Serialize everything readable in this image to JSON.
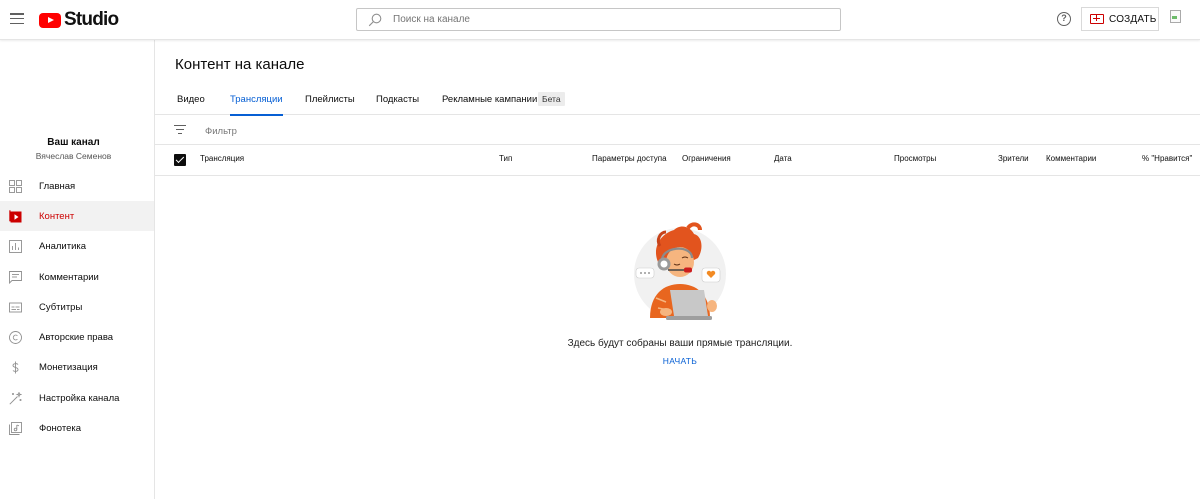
{
  "header": {
    "logo_text": "Studio",
    "search_placeholder": "Поиск на канале",
    "help_symbol": "?",
    "create_label": "СОЗДАТЬ"
  },
  "sidebar": {
    "channel_title": "Ваш канал",
    "channel_name": "Вячеслав Семенов",
    "items": [
      {
        "label": "Главная",
        "icon": "dashboard-icon"
      },
      {
        "label": "Контент",
        "icon": "content-icon",
        "active": true
      },
      {
        "label": "Аналитика",
        "icon": "analytics-icon"
      },
      {
        "label": "Комментарии",
        "icon": "comments-icon"
      },
      {
        "label": "Субтитры",
        "icon": "subtitles-icon"
      },
      {
        "label": "Авторские права",
        "icon": "copyright-icon"
      },
      {
        "label": "Монетизация",
        "icon": "monetization-icon"
      },
      {
        "label": "Настройка канала",
        "icon": "customization-icon"
      },
      {
        "label": "Фонотека",
        "icon": "audio-library-icon"
      }
    ]
  },
  "main": {
    "page_title": "Контент на канале",
    "tabs": [
      {
        "label": "Видео"
      },
      {
        "label": "Трансляции",
        "active": true
      },
      {
        "label": "Плейлисты"
      },
      {
        "label": "Подкасты"
      },
      {
        "label": "Рекламные кампании",
        "badge": "Бета"
      }
    ],
    "filter_placeholder": "Фильтр",
    "columns": [
      "Трансляция",
      "Тип",
      "Параметры доступа",
      "Ограничения",
      "Дата",
      "Просмотры",
      "Зрители",
      "Комментарии",
      "% \"Нравится\""
    ],
    "empty_text": "Здесь будут собраны ваши прямые трансляции.",
    "start_label": "НАЧАТЬ"
  },
  "colors": {
    "accent_blue": "#065fd4",
    "brand_red": "#ff0000",
    "active_red": "#cc0000"
  }
}
